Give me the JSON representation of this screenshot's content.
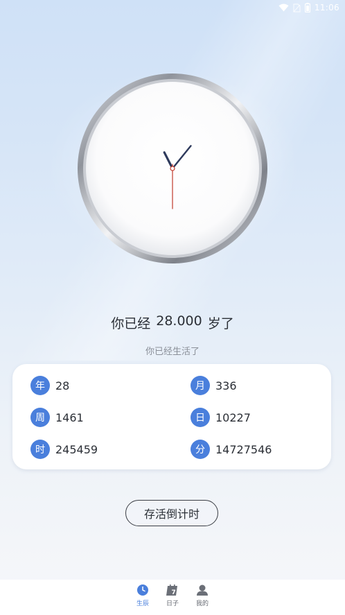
{
  "status_bar": {
    "time": "11:06",
    "icons": [
      "wifi-icon",
      "no-sim-icon",
      "battery-icon"
    ]
  },
  "clock": {
    "hour": 11,
    "minute": 6,
    "second": 30
  },
  "age": {
    "prefix": "你已经",
    "value": "28.000",
    "suffix": "岁了"
  },
  "subtitle": "你已经生活了",
  "stats": [
    {
      "badge": "年",
      "value": "28"
    },
    {
      "badge": "月",
      "value": "336"
    },
    {
      "badge": "周",
      "value": "1461"
    },
    {
      "badge": "日",
      "value": "10227"
    },
    {
      "badge": "时",
      "value": "245459"
    },
    {
      "badge": "分",
      "value": "14727546"
    }
  ],
  "countdown_button": "存活倒计时",
  "nav": [
    {
      "label": "生辰",
      "icon": "clock-icon",
      "active": true
    },
    {
      "label": "日子",
      "icon": "calendar-icon",
      "active": false
    },
    {
      "label": "我的",
      "icon": "user-icon",
      "active": false
    }
  ],
  "colors": {
    "accent": "#4a7fdc",
    "text": "#2b2f36",
    "muted": "#8a8f98",
    "second_hand": "#c0392b",
    "hands": "#2e3a5c"
  }
}
